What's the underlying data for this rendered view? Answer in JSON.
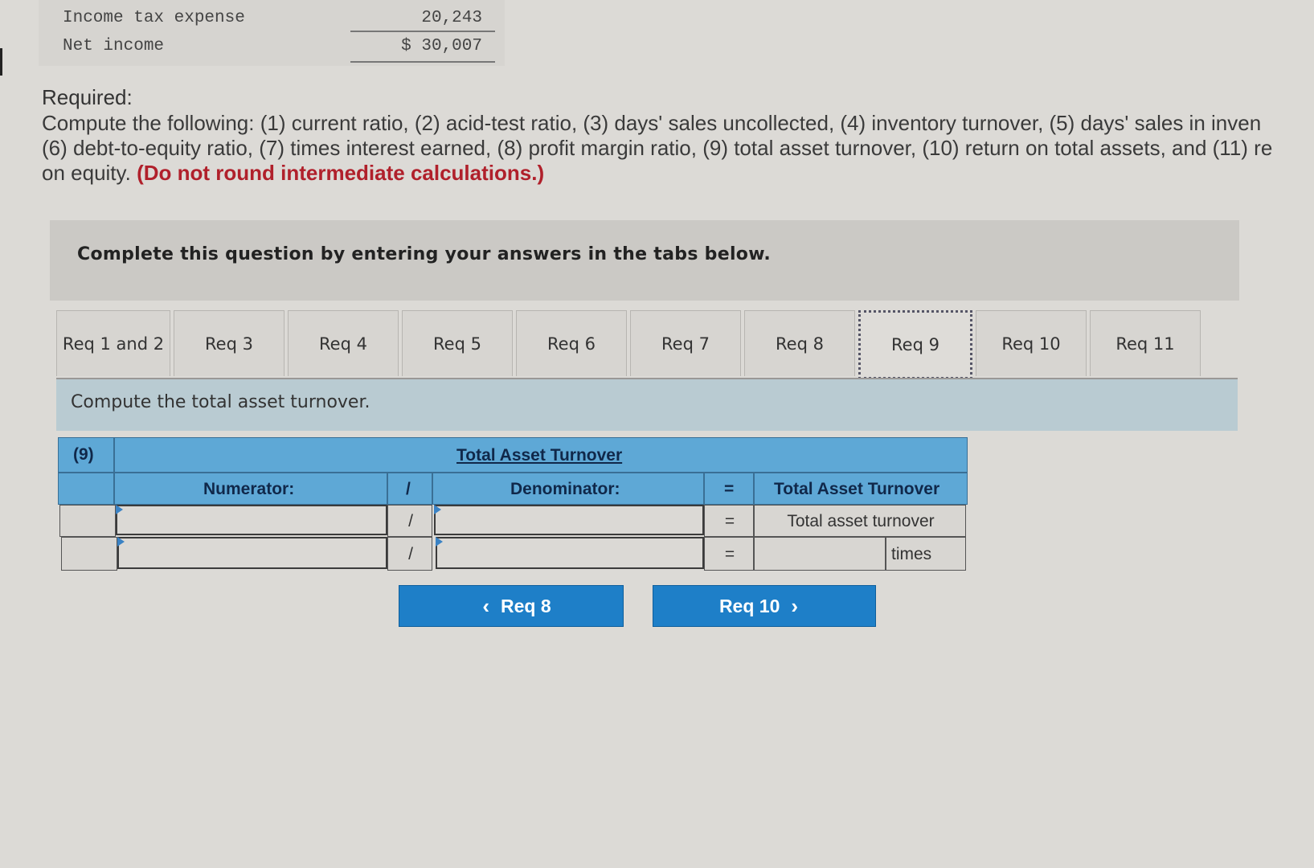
{
  "statement": {
    "rows": [
      {
        "label": "Income tax expense",
        "value": "20,243"
      },
      {
        "label": "Net income",
        "value": "$ 30,007"
      }
    ]
  },
  "required": {
    "title": "Required:",
    "line1": "Compute the following: (1) current ratio, (2) acid-test ratio, (3) days' sales uncollected, (4) inventory turnover, (5) days' sales in inven",
    "line2": "(6) debt-to-equity ratio, (7) times interest earned, (8) profit margin ratio, (9) total asset turnover, (10) return on total assets, and (11) re",
    "line3_plain": "on equity.",
    "line3_red": "(Do not round intermediate calculations.)"
  },
  "instruction": "Complete this question by entering your answers in the tabs below.",
  "tabs": [
    {
      "label": "Req 1 and 2",
      "active": false
    },
    {
      "label": "Req 3",
      "active": false
    },
    {
      "label": "Req 4",
      "active": false
    },
    {
      "label": "Req 5",
      "active": false
    },
    {
      "label": "Req 6",
      "active": false
    },
    {
      "label": "Req 7",
      "active": false
    },
    {
      "label": "Req 8",
      "active": false
    },
    {
      "label": "Req 9",
      "active": true
    },
    {
      "label": "Req 10",
      "active": false
    },
    {
      "label": "Req 11",
      "active": false
    }
  ],
  "prompt": "Compute the total asset turnover.",
  "table": {
    "item_number": "(9)",
    "title": "Total Asset Turnover",
    "numerator_header": "Numerator:",
    "divide_symbol": "/",
    "denominator_header": "Denominator:",
    "equals_symbol": "=",
    "result_header": "Total Asset Turnover",
    "rows": [
      {
        "numerator": "",
        "denominator": "",
        "result": "Total asset turnover",
        "unit": ""
      },
      {
        "numerator": "",
        "denominator": "",
        "result": "",
        "unit": "times"
      }
    ]
  },
  "nav": {
    "prev_label": "Req 8",
    "next_label": "Req 10"
  },
  "colors": {
    "header_blue": "#5ea8d6",
    "button_blue": "#1e7fc8",
    "warning_red": "#b0202b",
    "prompt_bar": "#b9cbd2"
  }
}
